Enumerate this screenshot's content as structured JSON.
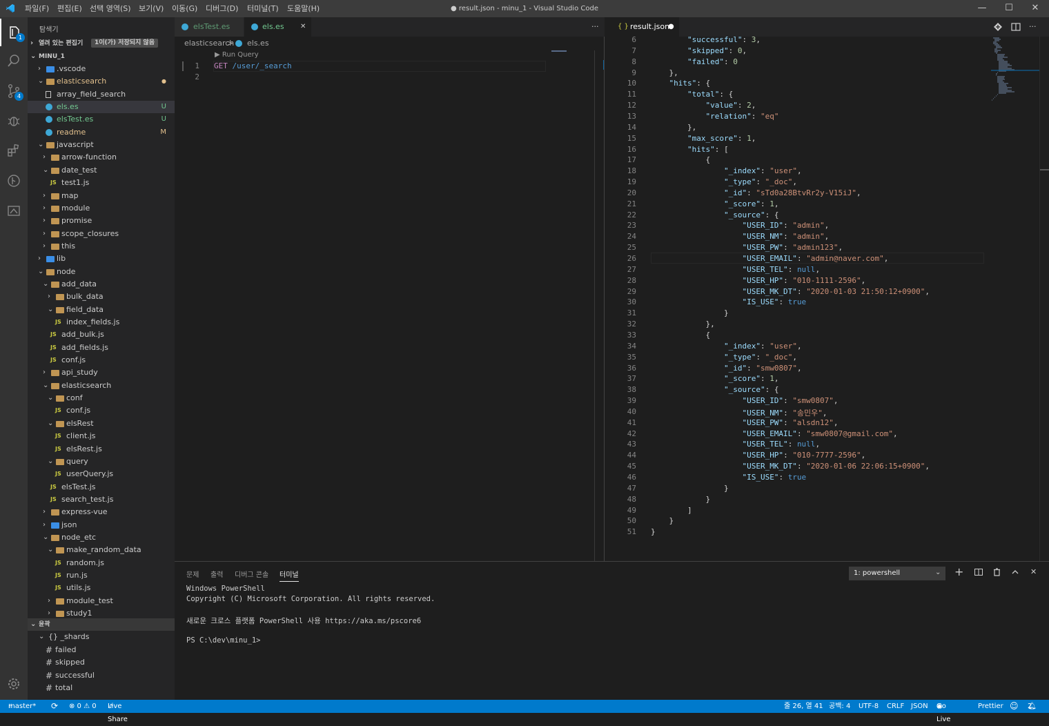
{
  "window": {
    "title": "● result.json - minu_1 - Visual Studio Code",
    "menu": [
      "파일(F)",
      "편집(E)",
      "선택 영역(S)",
      "보기(V)",
      "이동(G)",
      "디버그(D)",
      "터미널(T)",
      "도움말(H)"
    ],
    "controls": {
      "minimize": "—",
      "maximize": "☐",
      "close": "✕"
    }
  },
  "activity_bar": {
    "icons": [
      "explorer-icon",
      "search-icon",
      "source-control-icon",
      "debug-icon",
      "extensions-icon",
      "git-graph-icon",
      "remote-icon"
    ],
    "explorer_badge": "1",
    "scm_badge": "4",
    "settings_icon": "gear-icon"
  },
  "sidebar": {
    "title": "탐색기",
    "open_editors": {
      "label": "열려 있는 편집기",
      "badge": "1이(가) 저장되지 않음"
    },
    "workspace": "MINU_1",
    "tree": [
      {
        "label": ".vscode",
        "depth": 1,
        "type": "folder-special",
        "open": false
      },
      {
        "label": "elasticsearch",
        "depth": 1,
        "type": "folder",
        "open": true,
        "color": "#e2c08d",
        "status": "●"
      },
      {
        "label": "array_field_search",
        "depth": 2,
        "type": "file"
      },
      {
        "label": "els.es",
        "depth": 2,
        "type": "es",
        "color": "#73c991",
        "status": "U",
        "selected": true
      },
      {
        "label": "elsTest.es",
        "depth": 2,
        "type": "es",
        "color": "#73c991",
        "status": "U"
      },
      {
        "label": "readme",
        "depth": 2,
        "type": "es",
        "color": "#e2c08d",
        "status": "M"
      },
      {
        "label": "javascript",
        "depth": 1,
        "type": "folder",
        "open": true
      },
      {
        "label": "arrow-function",
        "depth": 2,
        "type": "folder",
        "open": false
      },
      {
        "label": "date_test",
        "depth": 2,
        "type": "folder",
        "open": true
      },
      {
        "label": "test1.js",
        "depth": 3,
        "type": "js"
      },
      {
        "label": "map",
        "depth": 2,
        "type": "folder",
        "open": false
      },
      {
        "label": "module",
        "depth": 2,
        "type": "folder",
        "open": false
      },
      {
        "label": "promise",
        "depth": 2,
        "type": "folder",
        "open": false
      },
      {
        "label": "scope_closures",
        "depth": 2,
        "type": "folder",
        "open": false
      },
      {
        "label": "this",
        "depth": 2,
        "type": "folder",
        "open": false
      },
      {
        "label": "lib",
        "depth": 1,
        "type": "folder-special",
        "open": false
      },
      {
        "label": "node",
        "depth": 1,
        "type": "folder",
        "open": true
      },
      {
        "label": "add_data",
        "depth": 2,
        "type": "folder",
        "open": true
      },
      {
        "label": "bulk_data",
        "depth": 3,
        "type": "folder",
        "open": false
      },
      {
        "label": "field_data",
        "depth": 3,
        "type": "folder",
        "open": true
      },
      {
        "label": "index_fields.js",
        "depth": 4,
        "type": "js"
      },
      {
        "label": "add_bulk.js",
        "depth": 3,
        "type": "js"
      },
      {
        "label": "add_fields.js",
        "depth": 3,
        "type": "js"
      },
      {
        "label": "conf.js",
        "depth": 3,
        "type": "js"
      },
      {
        "label": "api_study",
        "depth": 2,
        "type": "folder",
        "open": false
      },
      {
        "label": "elasticsearch",
        "depth": 2,
        "type": "folder",
        "open": true
      },
      {
        "label": "conf",
        "depth": 3,
        "type": "folder",
        "open": true
      },
      {
        "label": "conf.js",
        "depth": 4,
        "type": "js"
      },
      {
        "label": "elsRest",
        "depth": 3,
        "type": "folder",
        "open": true
      },
      {
        "label": "client.js",
        "depth": 4,
        "type": "js"
      },
      {
        "label": "elsRest.js",
        "depth": 4,
        "type": "js"
      },
      {
        "label": "query",
        "depth": 3,
        "type": "folder",
        "open": true
      },
      {
        "label": "userQuery.js",
        "depth": 4,
        "type": "js"
      },
      {
        "label": "elsTest.js",
        "depth": 3,
        "type": "js"
      },
      {
        "label": "search_test.js",
        "depth": 3,
        "type": "js"
      },
      {
        "label": "express-vue",
        "depth": 2,
        "type": "folder",
        "open": false
      },
      {
        "label": "json",
        "depth": 2,
        "type": "folder-special",
        "open": false
      },
      {
        "label": "node_etc",
        "depth": 2,
        "type": "folder",
        "open": true
      },
      {
        "label": "make_random_data",
        "depth": 3,
        "type": "folder",
        "open": true
      },
      {
        "label": "random.js",
        "depth": 4,
        "type": "js"
      },
      {
        "label": "run.js",
        "depth": 4,
        "type": "js"
      },
      {
        "label": "utils.js",
        "depth": 4,
        "type": "js"
      },
      {
        "label": "module_test",
        "depth": 3,
        "type": "folder",
        "open": false
      },
      {
        "label": "study1",
        "depth": 3,
        "type": "folder",
        "open": false
      }
    ],
    "outline": {
      "label": "윤곽",
      "items": [
        {
          "label": "{} _shards",
          "depth": 1,
          "type": "obj",
          "open": true
        },
        {
          "label": "failed",
          "depth": 2,
          "type": "hash"
        },
        {
          "label": "skipped",
          "depth": 2,
          "type": "hash"
        },
        {
          "label": "successful",
          "depth": 2,
          "type": "hash"
        },
        {
          "label": "total",
          "depth": 2,
          "type": "hash"
        }
      ]
    }
  },
  "editor_left": {
    "tabs": [
      {
        "label": "elsTest.es",
        "active": false
      },
      {
        "label": "els.es",
        "active": true,
        "close": "✕"
      }
    ],
    "more": "···",
    "breadcrumb": {
      "folder": "elasticsearch",
      "sep": ">",
      "file": "els.es"
    },
    "codelens": "Run Query",
    "lines": [
      {
        "num": "1",
        "method": "GET",
        "path": "/user/_search"
      },
      {
        "num": "2",
        "method": "",
        "path": ""
      }
    ]
  },
  "editor_right": {
    "tab": {
      "icon": "{ }",
      "label": "result.json",
      "dirty": "●"
    },
    "actions": [
      "open-changes-icon",
      "split-editor-icon",
      "more-actions-icon"
    ],
    "lines": [
      {
        "n": "6",
        "t": "        \"successful\": 3,"
      },
      {
        "n": "7",
        "t": "        \"skipped\": 0,"
      },
      {
        "n": "8",
        "t": "        \"failed\": 0"
      },
      {
        "n": "9",
        "t": "    },"
      },
      {
        "n": "10",
        "t": "    \"hits\": {"
      },
      {
        "n": "11",
        "t": "        \"total\": {"
      },
      {
        "n": "12",
        "t": "            \"value\": 2,"
      },
      {
        "n": "13",
        "t": "            \"relation\": \"eq\""
      },
      {
        "n": "14",
        "t": "        },"
      },
      {
        "n": "15",
        "t": "        \"max_score\": 1,"
      },
      {
        "n": "16",
        "t": "        \"hits\": ["
      },
      {
        "n": "17",
        "t": "            {"
      },
      {
        "n": "18",
        "t": "                \"_index\": \"user\","
      },
      {
        "n": "19",
        "t": "                \"_type\": \"_doc\","
      },
      {
        "n": "20",
        "t": "                \"_id\": \"sTd0a28BtvRr2y-V15iJ\","
      },
      {
        "n": "21",
        "t": "                \"_score\": 1,"
      },
      {
        "n": "22",
        "t": "                \"_source\": {"
      },
      {
        "n": "23",
        "t": "                    \"USER_ID\": \"admin\","
      },
      {
        "n": "24",
        "t": "                    \"USER_NM\": \"admin\","
      },
      {
        "n": "25",
        "t": "                    \"USER_PW\": \"admin123\","
      },
      {
        "n": "26",
        "t": "                    \"USER_EMAIL\": \"admin@naver.com\","
      },
      {
        "n": "27",
        "t": "                    \"USER_TEL\": null,"
      },
      {
        "n": "28",
        "t": "                    \"USER_HP\": \"010-1111-2596\","
      },
      {
        "n": "29",
        "t": "                    \"USER_MK_DT\": \"2020-01-03 21:50:12+0900\","
      },
      {
        "n": "30",
        "t": "                    \"IS_USE\": true"
      },
      {
        "n": "31",
        "t": "                }"
      },
      {
        "n": "32",
        "t": "            },"
      },
      {
        "n": "33",
        "t": "            {"
      },
      {
        "n": "34",
        "t": "                \"_index\": \"user\","
      },
      {
        "n": "35",
        "t": "                \"_type\": \"_doc\","
      },
      {
        "n": "36",
        "t": "                \"_id\": \"smw0807\","
      },
      {
        "n": "37",
        "t": "                \"_score\": 1,"
      },
      {
        "n": "38",
        "t": "                \"_source\": {"
      },
      {
        "n": "39",
        "t": "                    \"USER_ID\": \"smw0807\","
      },
      {
        "n": "40",
        "t": "                    \"USER_NM\": \"송민우\","
      },
      {
        "n": "41",
        "t": "                    \"USER_PW\": \"alsdn12\","
      },
      {
        "n": "42",
        "t": "                    \"USER_EMAIL\": \"smw0807@gmail.com\","
      },
      {
        "n": "43",
        "t": "                    \"USER_TEL\": null,"
      },
      {
        "n": "44",
        "t": "                    \"USER_HP\": \"010-7777-2596\","
      },
      {
        "n": "45",
        "t": "                    \"USER_MK_DT\": \"2020-01-06 22:06:15+0900\","
      },
      {
        "n": "46",
        "t": "                    \"IS_USE\": true"
      },
      {
        "n": "47",
        "t": "                }"
      },
      {
        "n": "48",
        "t": "            }"
      },
      {
        "n": "49",
        "t": "        ]"
      },
      {
        "n": "50",
        "t": "    }"
      },
      {
        "n": "51",
        "t": "}"
      }
    ]
  },
  "panel": {
    "tabs": [
      "문제",
      "출력",
      "디버그 콘솔",
      "터미널"
    ],
    "active_tab": "터미널",
    "terminal_select": "1: powershell",
    "actions": {
      "add": "+",
      "split": "⫴",
      "trash": "🗑",
      "maximize": "^",
      "close": "✕"
    },
    "terminal_lines": [
      "Windows PowerShell",
      "Copyright (C) Microsoft Corporation. All rights reserved.",
      "",
      "새로운 크로스 플랫폼 PowerShell 사용 https://aka.ms/pscore6",
      "",
      "PS C:\\dev\\minu_1>"
    ]
  },
  "statusbar": {
    "branch": "master*",
    "sync": "⟳",
    "problems": "⊗ 0 ⚠ 0",
    "live_share": "Live Share",
    "cursor": "줄 26, 열 41",
    "indent": "공백: 4",
    "encoding": "UTF-8",
    "eol": "CRLF",
    "language": "JSON",
    "go_live": "Go Live",
    "prettier": "Prettier",
    "feedback": "☺",
    "notifications": "2"
  },
  "colors": {
    "accent": "#007acc",
    "untracked": "#73c991",
    "modified": "#e2c08d",
    "js": "#cbcb41"
  }
}
